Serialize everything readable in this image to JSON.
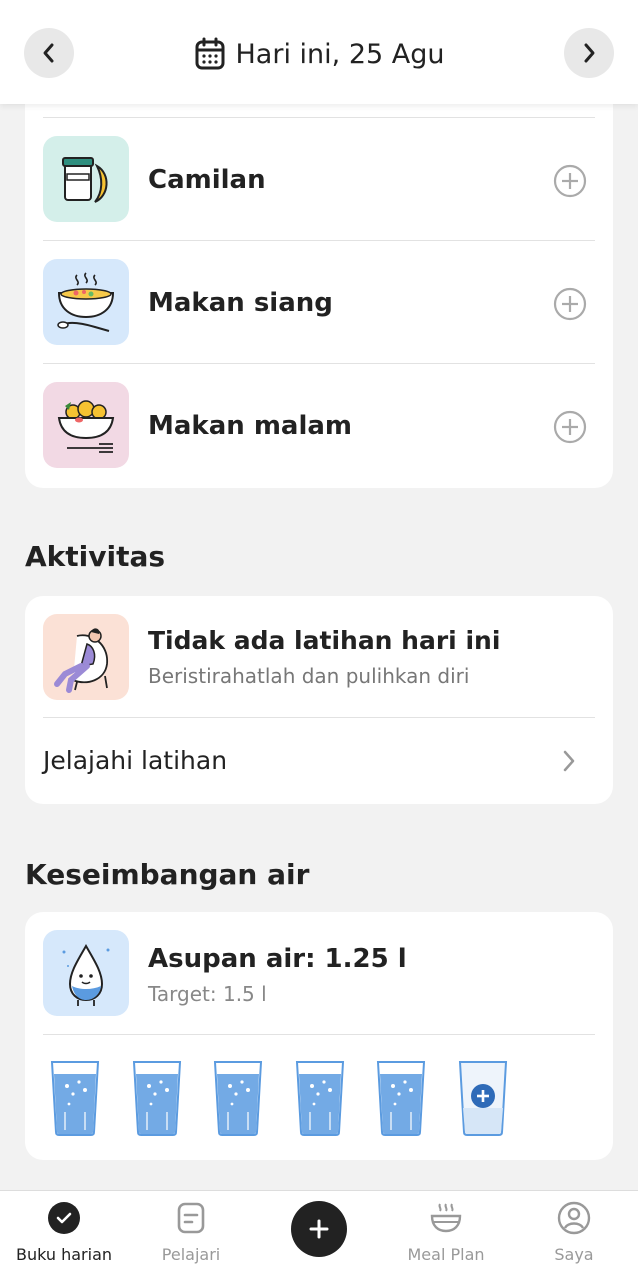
{
  "header": {
    "date_label": "Hari ini, 25 Agu",
    "prev_icon": "chevron-left-icon",
    "next_icon": "chevron-right-icon",
    "calendar_icon": "calendar-icon"
  },
  "meals": [
    {
      "label": "Camilan",
      "icon": "snack-icon",
      "bg": "#d4efea"
    },
    {
      "label": "Makan siang",
      "icon": "lunch-icon",
      "bg": "#d6e8fb"
    },
    {
      "label": "Makan malam",
      "icon": "dinner-icon",
      "bg": "#f2d9e4"
    }
  ],
  "activity": {
    "section_title": "Aktivitas",
    "title": "Tidak ada latihan hari ini",
    "subtitle": "Beristirahatlah dan pulihkan diri",
    "explore_label": "Jelajahi latihan"
  },
  "water": {
    "section_title": "Keseimbangan air",
    "title": "Asupan air: 1.25 l",
    "target": "Target: 1.5 l",
    "glasses_filled": 5,
    "glasses_total": 6
  },
  "nav": {
    "items": [
      {
        "label": "Buku harian",
        "icon": "check-circle-icon",
        "active": true
      },
      {
        "label": "Pelajari",
        "icon": "document-icon",
        "active": false
      },
      {
        "label": "Meal Plan",
        "icon": "bowl-icon",
        "active": false
      },
      {
        "label": "Saya",
        "icon": "profile-icon",
        "active": false
      }
    ],
    "fab_icon": "plus-icon"
  },
  "colors": {
    "accent": "#222222",
    "water_blue": "#5b9be0",
    "background": "#f2f2f2"
  }
}
